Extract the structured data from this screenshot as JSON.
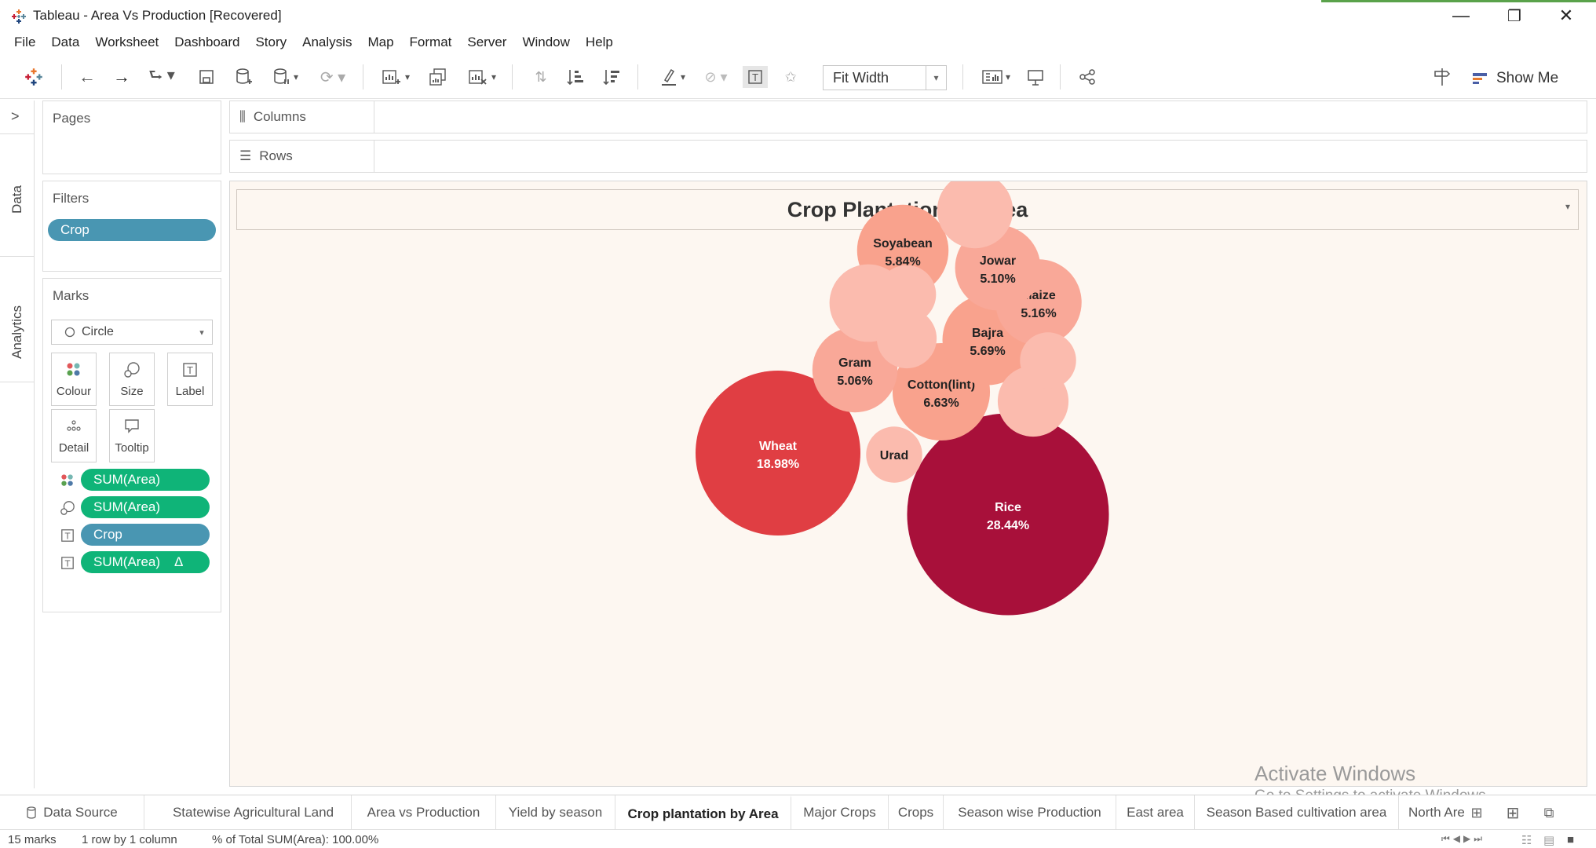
{
  "window": {
    "title": "Tableau - Area Vs Production [Recovered]",
    "minimize_glyph": "—",
    "restore_glyph": "❐",
    "close_glyph": "✕"
  },
  "menu": [
    "File",
    "Data",
    "Worksheet",
    "Dashboard",
    "Story",
    "Analysis",
    "Map",
    "Format",
    "Server",
    "Window",
    "Help"
  ],
  "toolbar": {
    "fit_value": "Fit Width",
    "show_me_label": "Show Me"
  },
  "left_tabs": {
    "data": "Data",
    "analytics": "Analytics"
  },
  "pages": {
    "title": "Pages"
  },
  "filters": {
    "title": "Filters",
    "items": [
      "Crop"
    ]
  },
  "marks": {
    "title": "Marks",
    "type": "Circle",
    "buttons": [
      "Colour",
      "Size",
      "Label",
      "Detail",
      "Tooltip"
    ],
    "pills": [
      {
        "icon": "colour-icon",
        "label": "SUM(Area)",
        "color": "#0fb478"
      },
      {
        "icon": "size-icon",
        "label": "SUM(Area)",
        "color": "#0fb478"
      },
      {
        "icon": "label-icon",
        "label": "Crop",
        "color": "#4996b2"
      },
      {
        "icon": "label-icon",
        "label": "SUM(Area)",
        "suffix": "Δ",
        "color": "#0fb478"
      }
    ]
  },
  "shelves": {
    "columns": "Columns",
    "rows": "Rows"
  },
  "view": {
    "title": "Crop Plantation by Area"
  },
  "chart_data": {
    "type": "packed-bubble",
    "title": "Crop Plantation by Area",
    "measure": "SUM(Area)",
    "label_format": "% of Total",
    "color_range": [
      "#fbcabb",
      "#a8103a"
    ],
    "bubbles": [
      {
        "name": "Rice",
        "pct": 28.44,
        "label": "Rice",
        "value_label": "28.44%",
        "color": "#a8103a",
        "text_color": "#ffffff"
      },
      {
        "name": "Wheat",
        "pct": 18.98,
        "label": "Wheat",
        "value_label": "18.98%",
        "color": "#e03e43",
        "text_color": "#ffffff"
      },
      {
        "name": "Cotton(lint)",
        "pct": 6.63,
        "label": "Cotton(lint)",
        "value_label": "6.63%",
        "color": "#f9a28d",
        "text_color": "#222222"
      },
      {
        "name": "Soyabean",
        "pct": 5.84,
        "label": "Soyabean",
        "value_label": "5.84%",
        "color": "#f9a28d",
        "text_color": "#222222"
      },
      {
        "name": "Bajra",
        "pct": 5.69,
        "label": "Bajra",
        "value_label": "5.69%",
        "color": "#f9a28d",
        "text_color": "#222222"
      },
      {
        "name": "Maize",
        "pct": 5.16,
        "label": "Maize",
        "value_label": "5.16%",
        "color": "#f9a898",
        "text_color": "#222222"
      },
      {
        "name": "Jowar",
        "pct": 5.1,
        "label": "Jowar",
        "value_label": "5.10%",
        "color": "#f9a898",
        "text_color": "#222222"
      },
      {
        "name": "Gram",
        "pct": 5.06,
        "label": "Gram",
        "value_label": "5.06%",
        "color": "#f9a898",
        "text_color": "#222222"
      },
      {
        "name": "Urad",
        "pct": 2.2,
        "label": "Urad",
        "value_label": "",
        "color": "#fbbbae",
        "text_color": "#222222"
      },
      {
        "name": "unlabeled-1",
        "pct": 4.2,
        "label": "",
        "value_label": "",
        "color": "#fbbbae"
      },
      {
        "name": "unlabeled-2",
        "pct": 4.0,
        "label": "",
        "value_label": "",
        "color": "#fbbbae"
      },
      {
        "name": "unlabeled-3",
        "pct": 3.5,
        "label": "",
        "value_label": "",
        "color": "#fbbbae"
      },
      {
        "name": "unlabeled-4",
        "pct": 2.5,
        "label": "",
        "value_label": "",
        "color": "#fbbbae"
      },
      {
        "name": "unlabeled-5",
        "pct": 2.4,
        "label": "",
        "value_label": "",
        "color": "#fbbbae"
      },
      {
        "name": "unlabeled-6",
        "pct": 2.2,
        "label": "",
        "value_label": "",
        "color": "#fbbbae"
      }
    ]
  },
  "watermark": {
    "line1": "Activate Windows",
    "line2": "Go to Settings to activate Windows."
  },
  "tabs": {
    "data_source": "Data Source",
    "sheets": [
      "Statewise Agricultural Land",
      "Area vs Production",
      "Yield by season",
      "Crop plantation by Area",
      "Major Crops",
      "Crops",
      "Season wise Production",
      "East area",
      "Season Based cultivation area",
      "North Are"
    ],
    "active": "Crop plantation by Area"
  },
  "status": {
    "marks": "15 marks",
    "dims": "1 row by 1 column",
    "sum": "% of Total SUM(Area): 100.00%"
  }
}
